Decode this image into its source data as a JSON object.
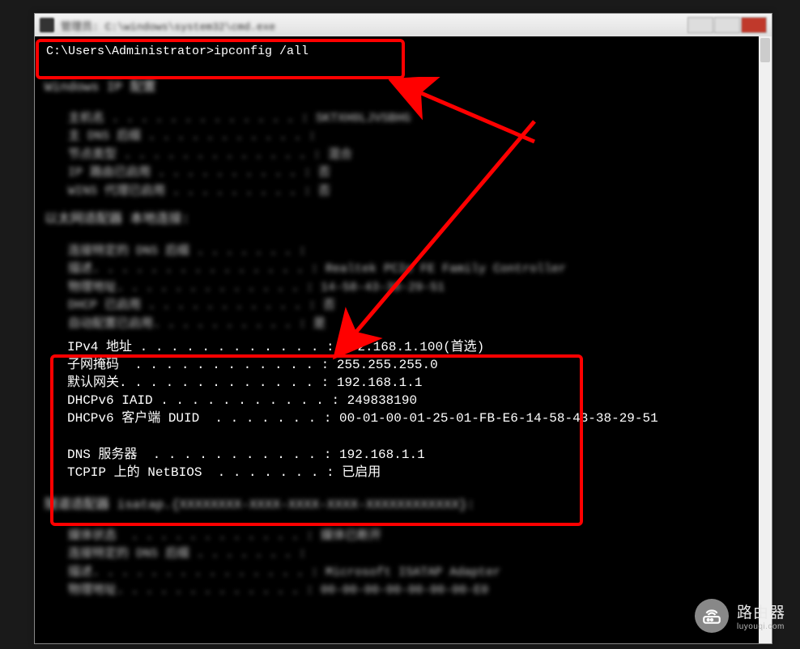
{
  "window": {
    "title": "管理员: C:\\windows\\system32\\cmd.exe"
  },
  "cmd": {
    "prompt": "C:\\Users\\Administrator>ipconfig /all"
  },
  "blurred": {
    "header1": "Windows IP 配置",
    "host_l1": "   主机名 . . . . . . . . . . . . . : SKTXH0LJVSBHG",
    "host_l2": "   主 DNS 后缀 . . . . . . . . . . . :",
    "host_l3": "   节点类型 . . . . . . . . . . . . . : 混合",
    "host_l4": "   IP 路由已启用 . . . . . . . . . . : 否",
    "host_l5": "   WINS 代理已启用 . . . . . . . . . : 否",
    "header2": "以太网适配器 本地连接:",
    "adp_l1": "   连接特定的 DNS 后缀 . . . . . . . :",
    "adp_l2": "   描述. . . . . . . . . . . . . . . : Realtek PCIe FE Family Controller",
    "adp_l3": "   物理地址. . . . . . . . . . . . . : 14-58-43-38-29-51",
    "adp_l4": "   DHCP 已启用 . . . . . . . . . . . : 否",
    "adp_l5": "   自动配置已启用. . . . . . . . . . : 是",
    "header3": "隧道适配器 isatap.{XXXXXXXX-XXXX-XXXX-XXXX-XXXXXXXXXXXX}:",
    "tun_l1": "   媒体状态  . . . . . . . . . . . . : 媒体已断开",
    "tun_l2": "   连接特定的 DNS 后缀 . . . . . . . :",
    "tun_l3": "   描述. . . . . . . . . . . . . . . : Microsoft ISATAP Adapter",
    "tun_l4": "   物理地址. . . . . . . . . . . . . : 00-00-00-00-00-00-00-E0"
  },
  "ipinfo": {
    "ipv4": "IPv4 地址 . . . . . . . . . . . . : 192.168.1.100(首选)",
    "subnet": "子网掩码  . . . . . . . . . . . . : 255.255.255.0",
    "gateway": "默认网关. . . . . . . . . . . . . : 192.168.1.1",
    "iaid": "DHCPv6 IAID . . . . . . . . . . . : 249838190",
    "duid": "DHCPv6 客户端 DUID  . . . . . . . : 00-01-00-01-25-01-FB-E6-14-58-43-38-29-51",
    "blank": "",
    "dns": "DNS 服务器  . . . . . . . . . . . : 192.168.1.1",
    "netbios": "TCPIP 上的 NetBIOS  . . . . . . . : 已启用"
  },
  "watermark": {
    "main": "路由器",
    "sub": "luyouqi.com"
  }
}
